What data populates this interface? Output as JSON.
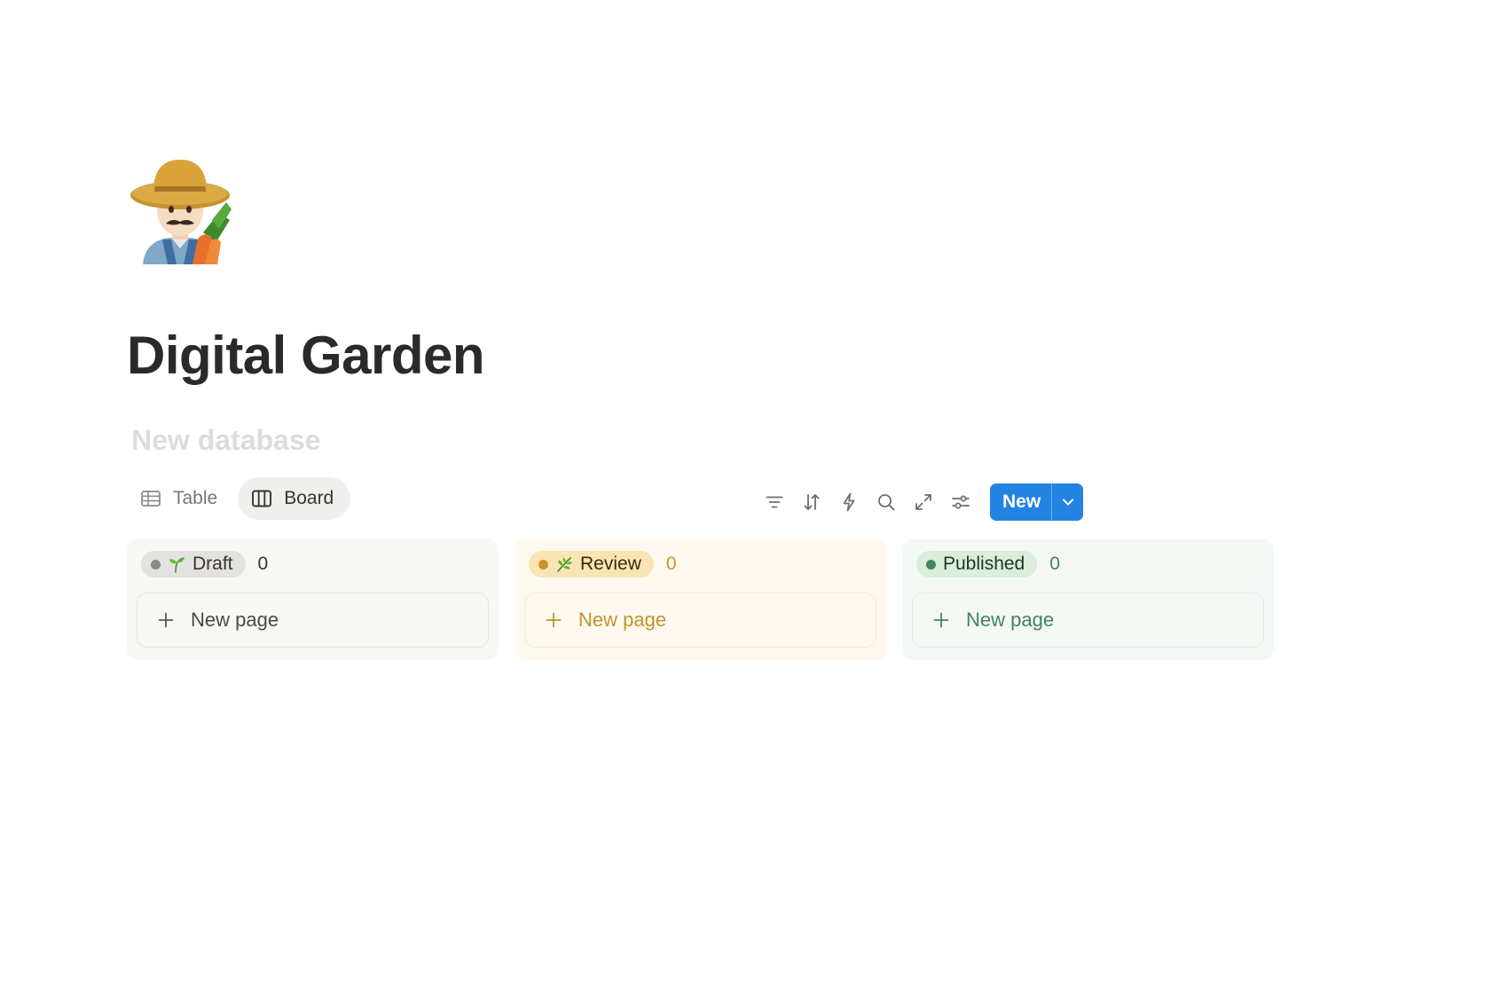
{
  "page": {
    "icon": "farmer-emoji",
    "title": "Digital Garden"
  },
  "database": {
    "title_placeholder": "New database"
  },
  "views": [
    {
      "label": "Table",
      "icon": "table-icon",
      "active": false
    },
    {
      "label": "Board",
      "icon": "board-icon",
      "active": true
    }
  ],
  "toolbar": {
    "icons": [
      "filter-icon",
      "sort-icon",
      "automation-icon",
      "search-icon",
      "expand-icon",
      "settings-icon"
    ],
    "new_label": "New"
  },
  "columns": [
    {
      "status": "Draft",
      "emoji": "seedling",
      "count": "0",
      "new_page_label": "New page",
      "color": "#8a8986"
    },
    {
      "status": "Review",
      "emoji": "herb",
      "count": "0",
      "new_page_label": "New page",
      "color": "#cb912f"
    },
    {
      "status": "Published",
      "emoji": "",
      "count": "0",
      "new_page_label": "New page",
      "color": "#448361"
    }
  ],
  "colors": {
    "accent": "#2383e2"
  }
}
